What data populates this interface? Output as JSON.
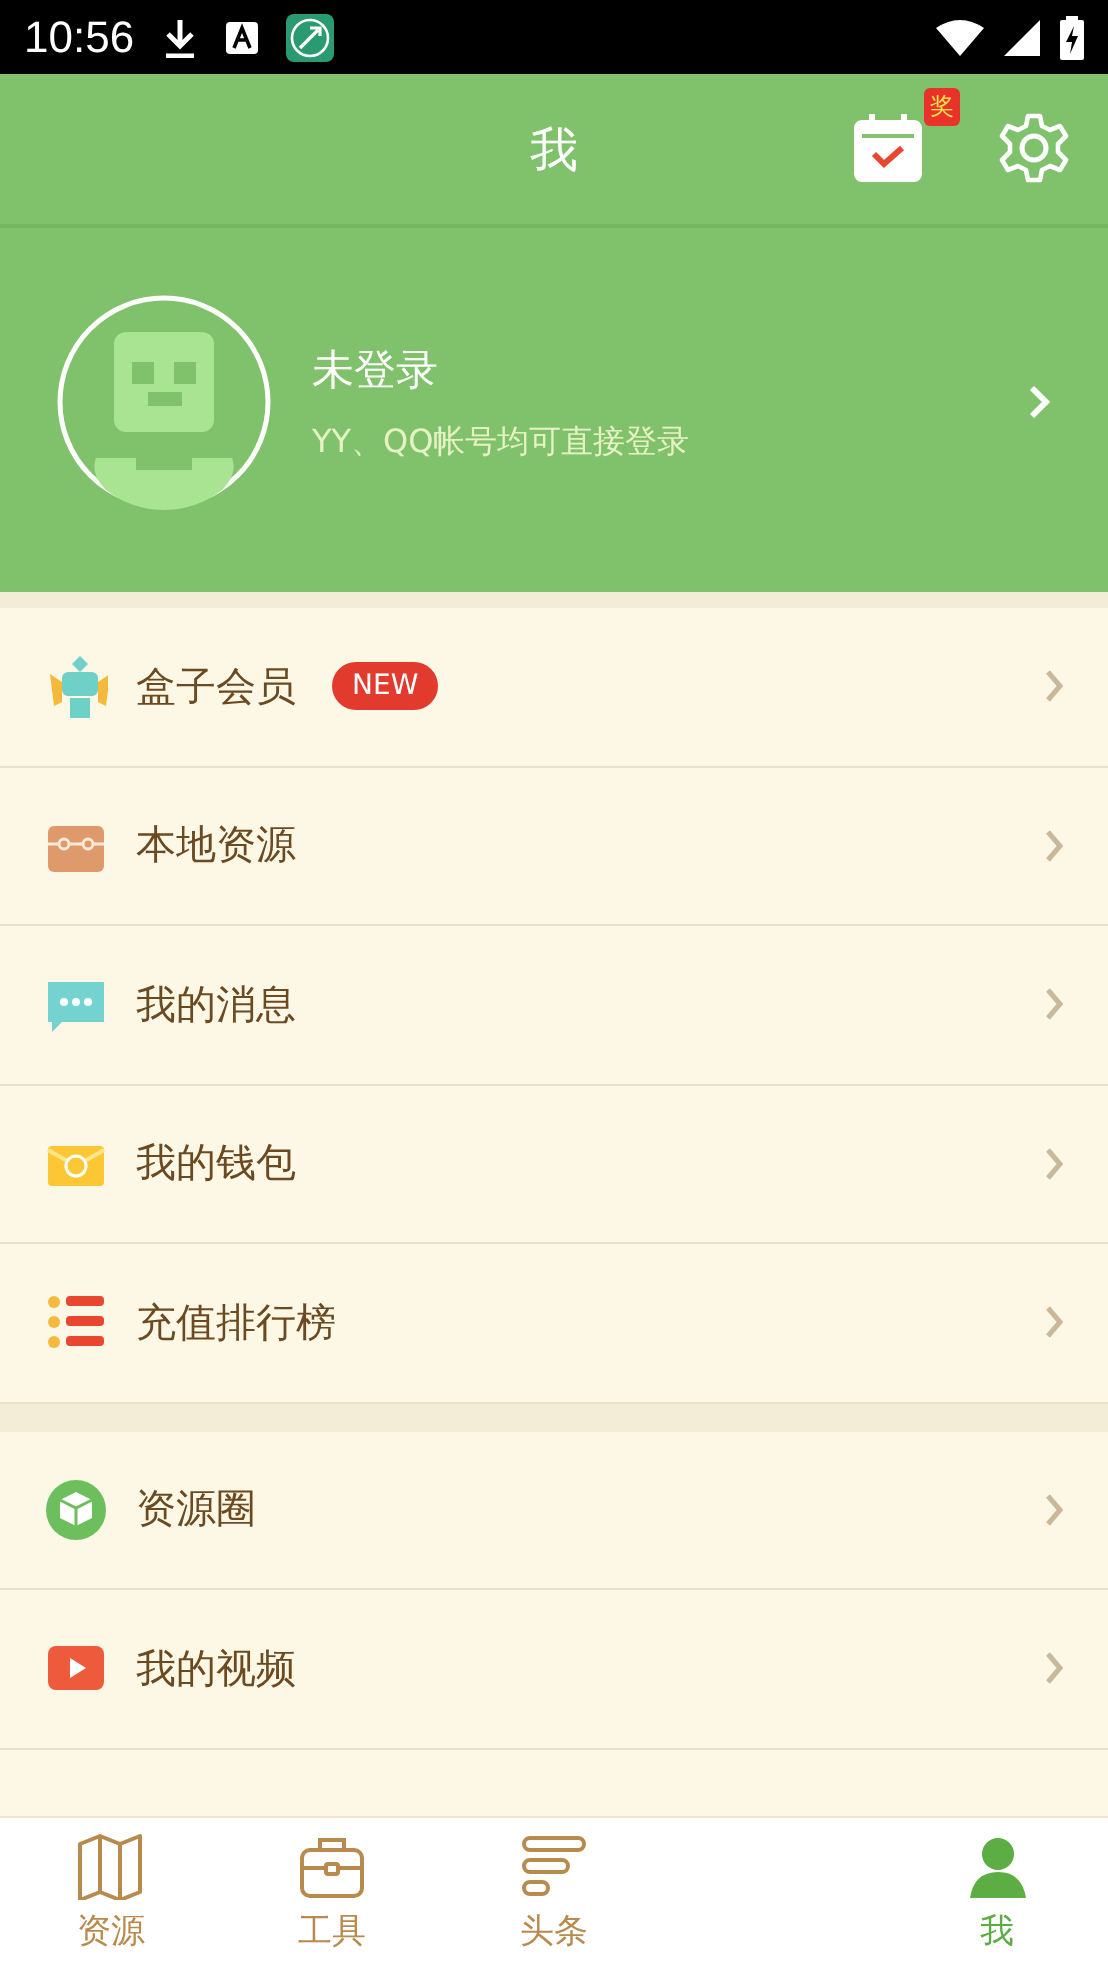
{
  "status_bar": {
    "time": "10:56"
  },
  "header": {
    "title": "我",
    "badge": "奖"
  },
  "profile": {
    "name": "未登录",
    "hint": "YY、QQ帐号均可直接登录"
  },
  "sections": [
    {
      "items": [
        {
          "kind": "vip",
          "label": "盒子会员",
          "badge": "NEW"
        },
        {
          "kind": "box",
          "label": "本地资源"
        },
        {
          "kind": "message",
          "label": "我的消息"
        },
        {
          "kind": "wallet",
          "label": "我的钱包"
        },
        {
          "kind": "rank",
          "label": "充值排行榜"
        }
      ]
    },
    {
      "items": [
        {
          "kind": "cube",
          "label": "资源圈"
        },
        {
          "kind": "video",
          "label": "我的视频"
        }
      ]
    }
  ],
  "nav": [
    {
      "kind": "map",
      "label": "资源",
      "selected": false
    },
    {
      "kind": "tool",
      "label": "工具",
      "selected": false
    },
    {
      "kind": "news",
      "label": "头条",
      "selected": false
    },
    {
      "kind": "me",
      "label": "我",
      "selected": true
    }
  ]
}
